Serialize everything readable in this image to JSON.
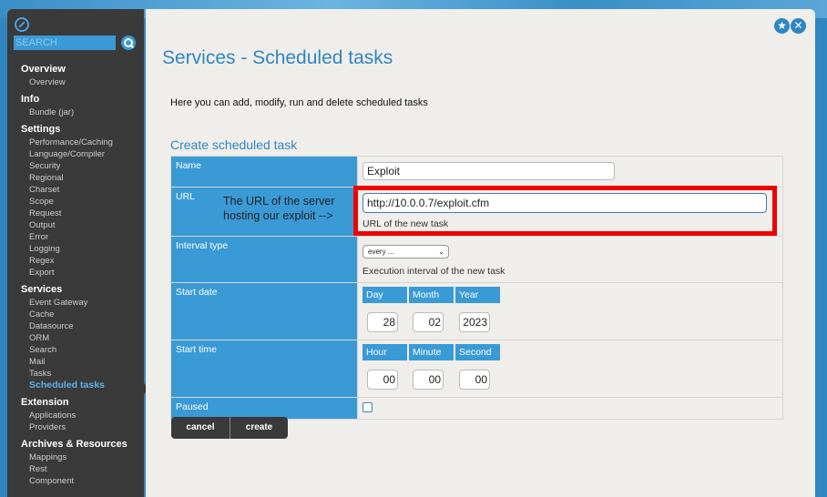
{
  "sidebar": {
    "search_placeholder": "SEARCH",
    "groups": [
      {
        "head": "Overview",
        "items": [
          "Overview"
        ]
      },
      {
        "head": "Info",
        "items": [
          "Bundle (jar)"
        ]
      },
      {
        "head": "Settings",
        "items": [
          "Performance/Caching",
          "Language/Compiler",
          "Security",
          "Regional",
          "Charset",
          "Scope",
          "Request",
          "Output",
          "Error",
          "Logging",
          "Regex",
          "Export"
        ]
      },
      {
        "head": "Services",
        "items": [
          "Event Gateway",
          "Cache",
          "Datasource",
          "ORM",
          "Search",
          "Mail",
          "Tasks",
          "Scheduled tasks"
        ]
      },
      {
        "head": "Extension",
        "items": [
          "Applications",
          "Providers"
        ]
      },
      {
        "head": "Archives & Resources",
        "items": [
          "Mappings",
          "Rest",
          "Component"
        ]
      }
    ],
    "active_item": "Scheduled tasks"
  },
  "header": {
    "icons": [
      "star-icon",
      "close-icon"
    ]
  },
  "page": {
    "title": "Services - Scheduled tasks",
    "intro": "Here you can add, modify, run and delete scheduled tasks",
    "section_title": "Create scheduled task"
  },
  "form": {
    "name": {
      "label": "Name",
      "value": "Exploit"
    },
    "url": {
      "label": "URL",
      "callout_line1": "The URL of the server",
      "callout_line2": "hosting our exploit -->",
      "value": "http://10.0.0.7/exploit.cfm",
      "hint": "URL of the new task"
    },
    "interval": {
      "label": "Interval type",
      "selected": "every ...",
      "hint": "Execution interval of the new task"
    },
    "start_date": {
      "label": "Start date",
      "headers": [
        "Day",
        "Month",
        "Year"
      ],
      "values": [
        "28",
        "02",
        "2023"
      ]
    },
    "start_time": {
      "label": "Start time",
      "headers": [
        "Hour",
        "Minute",
        "Second"
      ],
      "values": [
        "00",
        "00",
        "00"
      ]
    },
    "paused": {
      "label": "Paused",
      "checked": false
    }
  },
  "buttons": {
    "cancel": "cancel",
    "create": "create"
  },
  "colors": {
    "accent": "#2f86c1",
    "label_bg": "#3a9ad6",
    "sidebar_bg": "#3a3a3a",
    "highlight": "#e00000"
  }
}
